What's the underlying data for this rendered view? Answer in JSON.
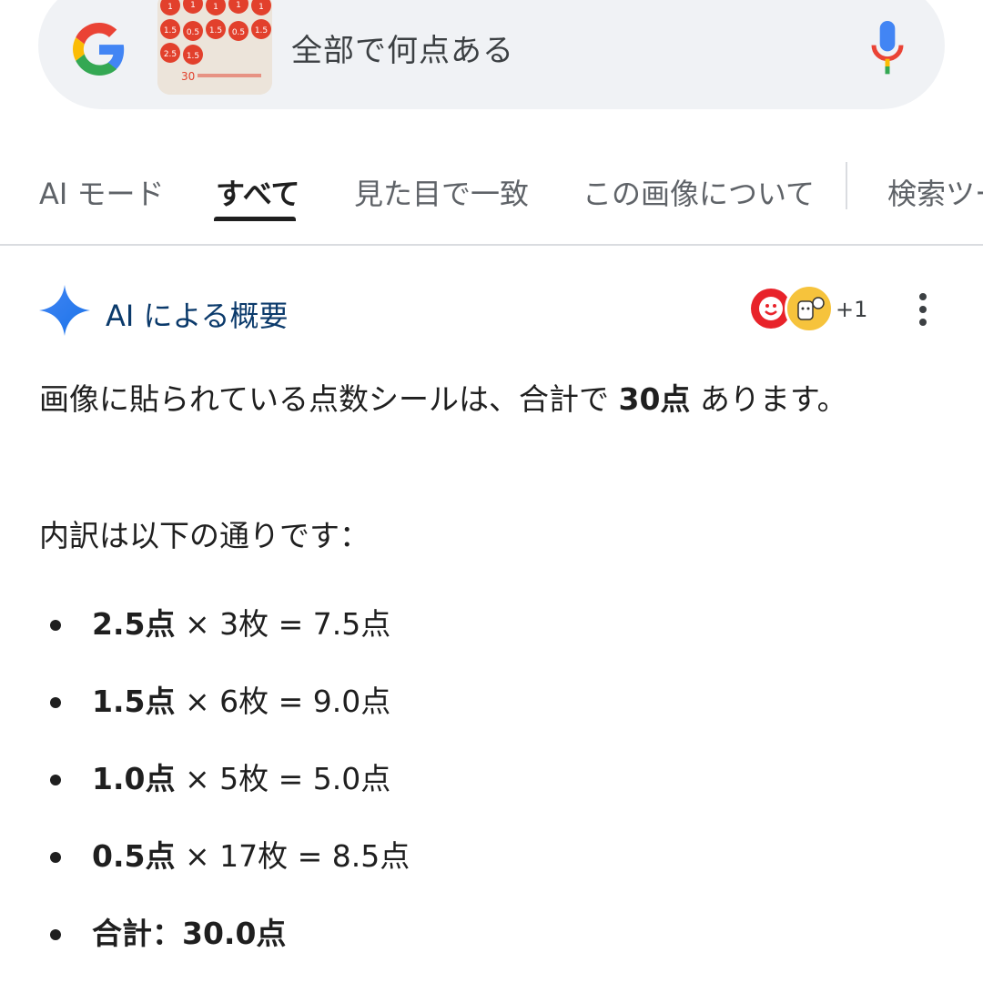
{
  "search": {
    "query": "全部で何点ある",
    "thumbnail_caption": "30"
  },
  "tabs": [
    {
      "label": "AI モード",
      "active": false
    },
    {
      "label": "すべて",
      "active": true
    },
    {
      "label": "見た目で一致",
      "active": false
    },
    {
      "label": "この画像について",
      "active": false
    },
    {
      "label": "検索ツー",
      "active": false
    }
  ],
  "ai_overview": {
    "title": "AI による概要",
    "sources_more": "+1",
    "summary_pre": "画像に貼られている点数シールは、合計で ",
    "summary_bold": "30点",
    "summary_post": " あります。",
    "breakdown_intro": "内訳は以下の通りです：",
    "items": [
      {
        "bold": "2.5点",
        "rest": " × 3枚 = 7.5点"
      },
      {
        "bold": "1.5点",
        "rest": " × 6枚 = 9.0点"
      },
      {
        "bold": "1.0点",
        "rest": " × 5枚 = 5.0点"
      },
      {
        "bold": "0.5点",
        "rest": " × 17枚 = 8.5点"
      },
      {
        "bold": "合計：30.0点",
        "rest": ""
      }
    ]
  },
  "colors": {
    "accent_blue": "#4285f4",
    "title_navy": "#0b3a6b",
    "sticker_red": "#e2402c"
  }
}
